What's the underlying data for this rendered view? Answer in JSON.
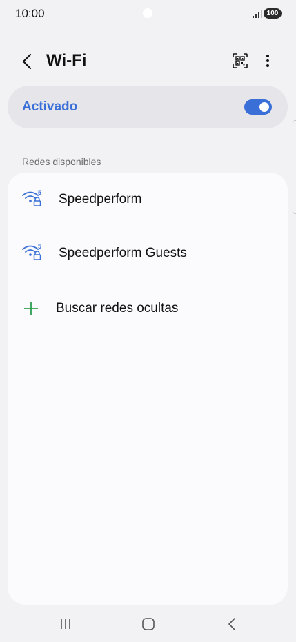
{
  "status_bar": {
    "time": "10:00",
    "battery": "100",
    "signal_icon": "signal-bars-icon"
  },
  "header": {
    "title": "Wi-Fi",
    "back_icon": "chevron-left-icon",
    "qr_icon": "qr-code-scan-icon",
    "more_icon": "more-vertical-icon"
  },
  "wifi_toggle": {
    "label": "Activado",
    "state": "on"
  },
  "available_networks": {
    "header": "Redes disponibles",
    "items": [
      {
        "name": "Speedperform",
        "band": "5",
        "secured": true
      },
      {
        "name": "Speedperform Guests",
        "band": "5",
        "secured": true
      }
    ],
    "add_network_label": "Buscar redes ocultas"
  },
  "colors": {
    "accent": "#3a6fd8",
    "add_green": "#2e9e4f",
    "background": "#f2f2f4",
    "card": "#fbfbfd"
  },
  "nav_bar": {
    "icons": [
      "recent-apps-icon",
      "home-icon",
      "back-icon"
    ]
  }
}
